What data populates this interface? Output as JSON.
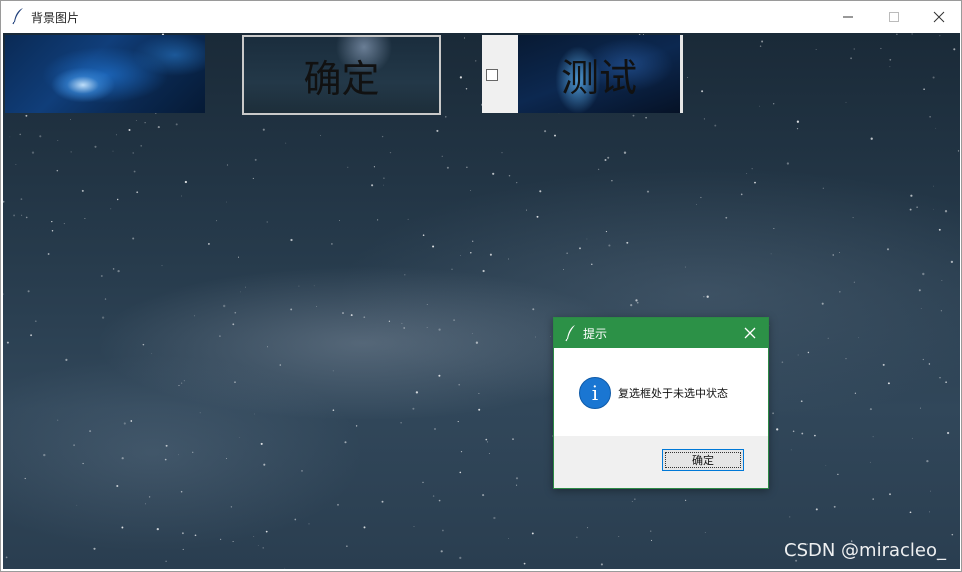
{
  "window": {
    "title": "背景图片",
    "icon": "feather-icon"
  },
  "controls": {
    "confirm_button_label": "确定",
    "checkbox_checked": false,
    "test_label": "测试"
  },
  "dialog": {
    "title": "提示",
    "icon": "info-icon",
    "info_glyph": "i",
    "message": "复选框处于未选中状态",
    "ok_label": "确定",
    "titlebar_color": "#2c9147"
  },
  "watermark": "CSDN @miracleo_"
}
